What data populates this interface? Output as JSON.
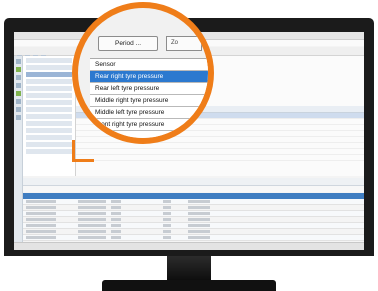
{
  "magnifier": {
    "period_button": "Period ...",
    "next_button_partial": "Zo",
    "dropdown": {
      "header": "Sensor",
      "selected_index": 0,
      "items": [
        "Rear right tyre pressure",
        "Rear left tyre pressure",
        "Middle right tyre pressure",
        "Middle left tyre pressure",
        "Front right tyre pressure"
      ]
    }
  },
  "colors": {
    "accent": "#ef7d19",
    "selection": "#2c79cf",
    "table_header": "#3f7dc1",
    "status_green": "#7dbb4a"
  }
}
